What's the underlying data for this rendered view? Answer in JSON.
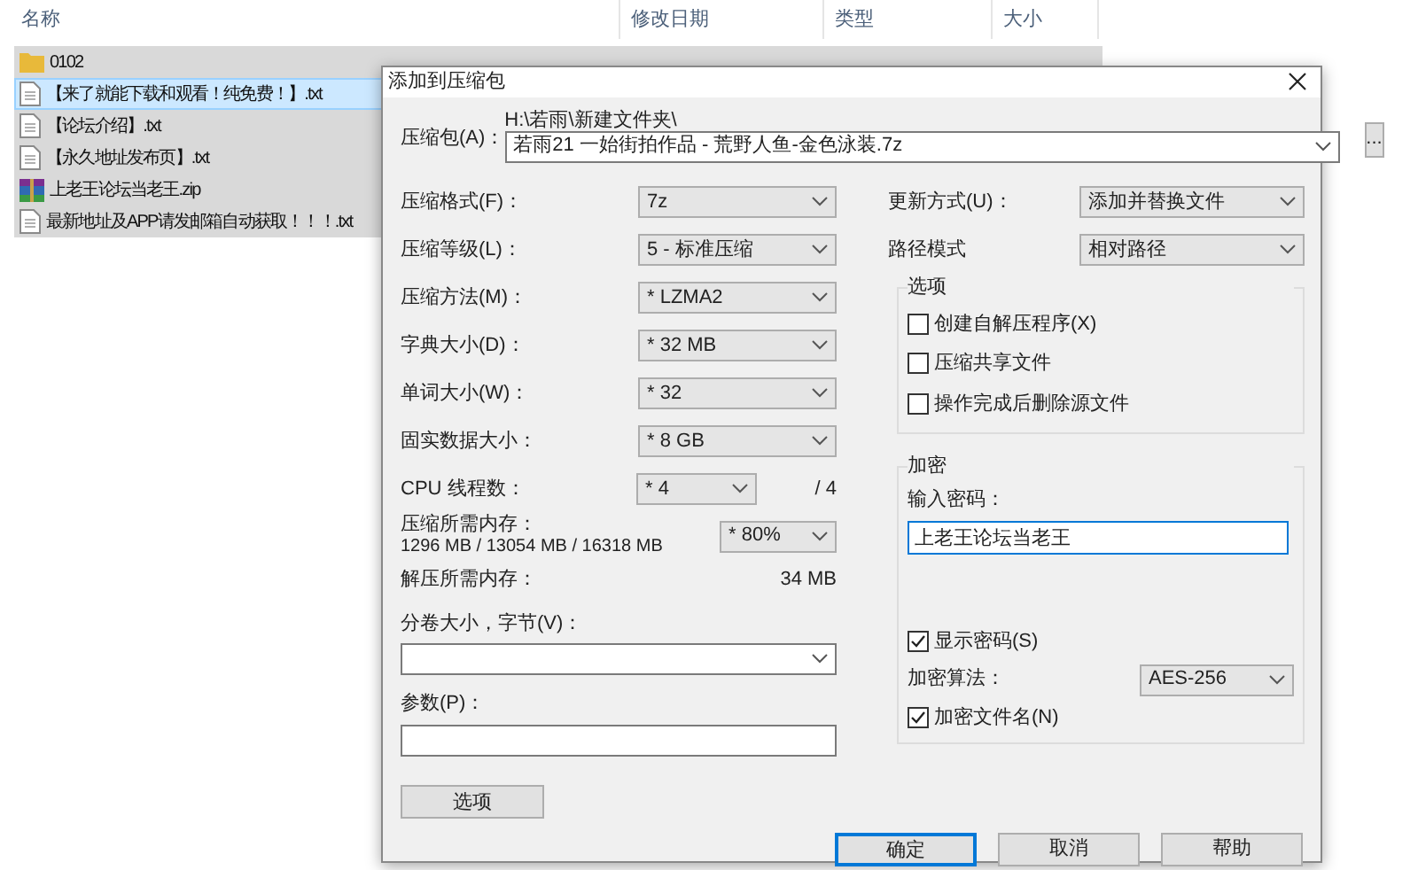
{
  "explorer": {
    "columns": [
      "名称",
      "修改日期",
      "类型",
      "大小"
    ],
    "files": [
      {
        "name": "0102",
        "kind": "folder",
        "focused": false
      },
      {
        "name": "【来了就能下载和观看！纯免费！】.txt",
        "kind": "txt",
        "focused": true
      },
      {
        "name": "【论坛介绍】.txt",
        "kind": "txt",
        "focused": false
      },
      {
        "name": "【永久地址发布页】.txt",
        "kind": "txt",
        "focused": false
      },
      {
        "name": "上老王论坛当老王.zip",
        "kind": "zip",
        "focused": false
      },
      {
        "name": "最新地址及APP请发邮箱自动获取！！！.txt",
        "kind": "txt",
        "focused": false
      }
    ]
  },
  "dialog": {
    "title": "添加到压缩包",
    "archive": {
      "label": "压缩包(A)：",
      "path": "H:\\若雨\\新建文件夹\\",
      "filename": "若雨21 一始街拍作品 - 荒野人鱼-金色泳装.7z",
      "browse": "..."
    },
    "left_fields": [
      {
        "label": "压缩格式(F)：",
        "value": "7z"
      },
      {
        "label": "压缩等级(L)：",
        "value": "5 - 标准压缩"
      },
      {
        "label": "压缩方法(M)：",
        "value": "* LZMA2"
      },
      {
        "label": "字典大小(D)：",
        "value": "* 32 MB"
      },
      {
        "label": "单词大小(W)：",
        "value": "* 32"
      },
      {
        "label": "固实数据大小：",
        "value": "* 8 GB"
      }
    ],
    "cpu": {
      "label": "CPU 线程数：",
      "value": "* 4",
      "max": "/ 4"
    },
    "memory": {
      "label": "压缩所需内存：",
      "detail": "1296 MB / 13054 MB / 16318 MB",
      "value": "* 80%"
    },
    "decompress_memory": {
      "label": "解压所需内存：",
      "value": "34 MB"
    },
    "volume": {
      "label": "分卷大小，字节(V)："
    },
    "params": {
      "label": "参数(P)："
    },
    "options_button": "选项",
    "right_fields": [
      {
        "label": "更新方式(U)：",
        "value": "添加并替换文件"
      },
      {
        "label": "路径模式",
        "value": "相对路径"
      }
    ],
    "options": {
      "title": "选项",
      "checkboxes": [
        {
          "label": "创建自解压程序(X)",
          "checked": false
        },
        {
          "label": "压缩共享文件",
          "checked": false
        },
        {
          "label": "操作完成后删除源文件",
          "checked": false
        }
      ]
    },
    "encryption": {
      "title": "加密",
      "password_label": "输入密码：",
      "password": "上老王论坛当老王",
      "show_password": {
        "label": "显示密码(S)",
        "checked": true
      },
      "method": {
        "label": "加密算法：",
        "value": "AES-256"
      },
      "encrypt_names": {
        "label": "加密文件名(N)",
        "checked": true
      }
    },
    "buttons": [
      {
        "label": "确定",
        "default": true
      },
      {
        "label": "取消",
        "default": false
      },
      {
        "label": "帮助",
        "default": false
      }
    ]
  }
}
